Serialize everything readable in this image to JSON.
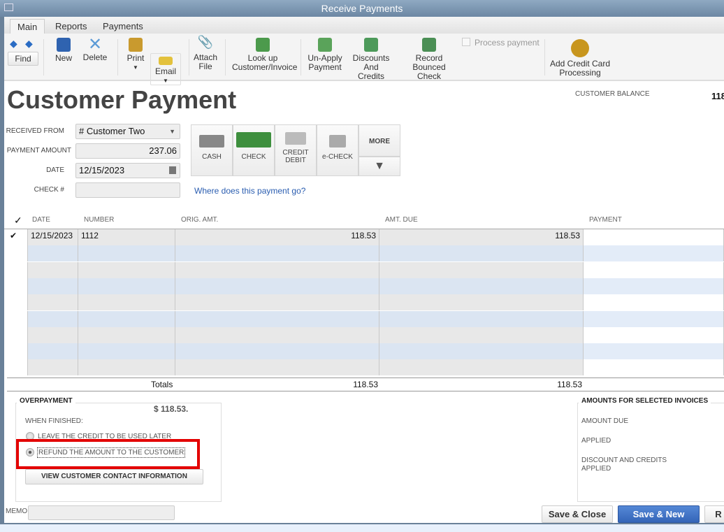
{
  "window": {
    "title": "Receive Payments"
  },
  "tabs": [
    {
      "label": "Main",
      "active": true
    },
    {
      "label": "Reports"
    },
    {
      "label": "Payments"
    }
  ],
  "toolbar": {
    "find": "Find",
    "new": "New",
    "delete": "Delete",
    "print": "Print",
    "email": "Email",
    "attach": [
      "Attach",
      "File"
    ],
    "lookup": [
      "Look up",
      "Customer/Invoice"
    ],
    "unapply": [
      "Un-Apply",
      "Payment"
    ],
    "discounts": [
      "Discounts And",
      "Credits"
    ],
    "bounced": [
      "Record",
      "Bounced Check"
    ],
    "process_payment": "Process payment",
    "add_cc": [
      "Add Credit Card",
      "Processing"
    ]
  },
  "form": {
    "title": "Customer Payment",
    "customer_balance_label": "CUSTOMER BALANCE",
    "customer_balance_value": "118",
    "received_from_label": "RECEIVED FROM",
    "received_from": "# Customer Two",
    "payment_amount_label": "PAYMENT AMOUNT",
    "payment_amount": "237.06",
    "date_label": "DATE",
    "date": "12/15/2023",
    "check_label": "CHECK #",
    "check": "",
    "where_link": "Where does this payment go?"
  },
  "methods": [
    {
      "label": "CASH",
      "icon": "cash-icon"
    },
    {
      "label": "CHECK",
      "icon": "check-icon",
      "selected": true
    },
    {
      "label": "CREDIT\nDEBIT",
      "icon": "credit-card-icon"
    },
    {
      "label": "e-CHECK",
      "icon": "echeck-icon"
    }
  ],
  "more": "MORE",
  "table": {
    "columns": [
      "✓",
      "DATE",
      "NUMBER",
      "ORIG. AMT.",
      "AMT. DUE",
      "PAYMENT"
    ],
    "rows": [
      {
        "checked": "✔",
        "date": "12/15/2023",
        "number": "1112",
        "orig": "118.53",
        "due": "118.53",
        "payment": ""
      }
    ],
    "totals_label": "Totals",
    "totals_orig": "118.53",
    "totals_due": "118.53"
  },
  "overpayment": {
    "title": "OVERPAYMENT",
    "amount": "$ 118.53.",
    "when_finished": "WHEN FINISHED:",
    "option_leave": "LEAVE THE CREDIT TO BE USED LATER",
    "option_refund": "REFUND THE AMOUNT TO THE CUSTOMER",
    "selected": "refund",
    "view_contact": "VIEW CUSTOMER CONTACT INFORMATION"
  },
  "amounts": {
    "title": "AMOUNTS FOR SELECTED INVOICES",
    "amount_due": "AMOUNT DUE",
    "applied": "APPLIED",
    "discount": "DISCOUNT AND CREDITS",
    "discount2": "APPLIED"
  },
  "memo_label": "MEMO",
  "memo": "",
  "buttons": {
    "save_close": "Save & Close",
    "save_new": "Save & New",
    "third": "R"
  },
  "colors": {
    "highlight": "#e30000",
    "primary": "#3e72c4",
    "link": "#2a5db0"
  }
}
